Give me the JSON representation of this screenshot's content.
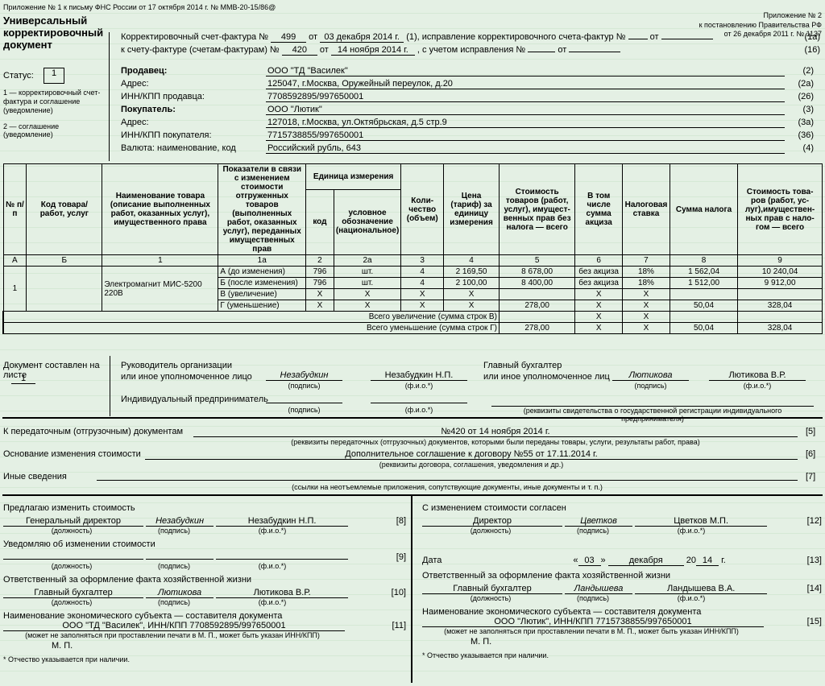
{
  "header": {
    "app1": "Приложение № 1 к письму ФНС России от 17 октября 2014 г. № ММВ-20-15/86@",
    "app2a": "Приложение № 2",
    "app2b": "к постановлению Правительства РФ",
    "app2c": "от 26 декабря 2011 г. № 1137"
  },
  "title": {
    "l1": "Универсальный",
    "l2": "корректировочный",
    "l3": "документ"
  },
  "status": {
    "label": "Статус:",
    "value": "1",
    "legend1": "1 — корректировочный счет-фактура и соглашение (уведомление)",
    "legend2": "2 — соглашение (уведомление)"
  },
  "corr": {
    "l1": "Корректировочный счет-фактура №",
    "n1": "499",
    "ot1": "от",
    "d1": "03 декабря 2014 г.",
    "fix": "(1), исправление корректировочного счета-фактур №",
    "ot3": "от",
    "b1": "(1а)",
    "l2": "к счету-фактуре (счетам-фактурам) №",
    "n2": "420",
    "ot2": "от",
    "d2": "14 ноября 2014 г.",
    "ispr": ", с учетом исправления №",
    "ot4": "от",
    "b2": "(16)"
  },
  "seller": {
    "label": "Продавец:",
    "name": "ООО \"ТД \"Василек\"",
    "addrlabel": "Адрес:",
    "addr": "125047, г.Москва, Оружейный переулок, д.20",
    "innlabel": "ИНН/КПП продавца:",
    "inn": "7708592895/997650001",
    "b1": "(2)",
    "b2": "(2а)",
    "b3": "(26)"
  },
  "buyer": {
    "label": "Покупатель:",
    "name": "ООО \"Лютик\"",
    "addrlabel": "Адрес:",
    "addr": "127018, г.Москва, ул.Октябрьская, д.5 стр.9",
    "innlabel": "ИНН/КПП покупателя:",
    "inn": "7715738855/997650001",
    "b1": "(3)",
    "b2": "(3а)",
    "b3": "(36)"
  },
  "currency": {
    "label": "Валюта: наименование, код",
    "value": "Российский рубль, 643",
    "b": "(4)"
  },
  "cols": {
    "c0": "№ п/п",
    "c1": "Код товара/ работ, услуг",
    "c2": "Наименование товара (описание выполненных работ, оказанных услуг), имущественного права",
    "c3": "Показатели в связи с изменением стоимости отгруженных товаров (выполненных работ, оказанных услуг), переданных имущественных прав",
    "c4": "Единица измерения",
    "c4a": "код",
    "c4b": "условное обозначение (национальное)",
    "c5": "Коли- чество (объем)",
    "c6": "Цена (тариф) за единицу измерения",
    "c7": "Стоимость товаров (работ, услуг), имущест- венных прав без налога — всего",
    "c8": "В том числе сумма акциза",
    "c9": "Налоговая ставка",
    "c10": "Сумма налога",
    "c11": "Стоимость това- ров (работ, ус- луг),имуществен- ных прав с нало- гом — всего"
  },
  "colnum": {
    "a": "А",
    "b": "Б",
    "c1": "1",
    "c1a": "1а",
    "c2": "2",
    "c2a": "2а",
    "c3": "3",
    "c4": "4",
    "c5": "5",
    "c6": "6",
    "c7": "7",
    "c8": "8",
    "c9": "9"
  },
  "row": {
    "n": "1",
    "name": "Электромагнит МИС-5200 220В",
    "rA": {
      "lbl": "А (до изменения)",
      "code": "796",
      "unit": "шт.",
      "qty": "4",
      "price": "2 169,50",
      "cost": "8 678,00",
      "acc": "без акциза",
      "rate": "18%",
      "tax": "1 562,04",
      "total": "10 240,04"
    },
    "rB": {
      "lbl": "Б (после изменения)",
      "code": "796",
      "unit": "шт.",
      "qty": "4",
      "price": "2 100,00",
      "cost": "8 400,00",
      "acc": "без акциза",
      "rate": "18%",
      "tax": "1 512,00",
      "total": "9 912,00"
    },
    "rV": {
      "lbl": "В (увеличение)",
      "code": "Х",
      "unit": "Х",
      "qty": "Х",
      "price": "Х",
      "cost": "",
      "acc": "Х",
      "rate": "Х",
      "tax": "",
      "total": ""
    },
    "rG": {
      "lbl": "Г (уменьшение)",
      "code": "Х",
      "unit": "Х",
      "qty": "Х",
      "price": "Х",
      "cost": "278,00",
      "acc": "Х",
      "rate": "Х",
      "tax": "50,04",
      "total": "328,04"
    }
  },
  "totals": {
    "inc": "Всего увеличение (сумма строк В)",
    "dec": "Всего уменьшение (сумма строк Г)",
    "x": "Х",
    "dcost": "278,00",
    "dtax": "50,04",
    "dtot": "328,04"
  },
  "sign": {
    "doclabel": "Документ составлен на листе",
    "page": "1",
    "rukorg": "Руководитель организации",
    "ili": "или иное уполномоченное лицо",
    "s1": "Незабудкин",
    "f1": "Незабудкин Н.П.",
    "glbuh": "Главный бухгалтер",
    "ili2": "или иное уполномоченное лиц",
    "s2": "Лютикова",
    "f2": "Лютикова В.Р.",
    "ip": "Индивидуальный предприниматель",
    "podp": "(подпись)",
    "fio": "(ф.и.о.*)",
    "rekv": "(реквизиты свидетельства о государственной регистрации индивидуального предпринимателя)"
  },
  "sec1": {
    "l": "К передаточным (отгрузочным) документам",
    "v": "№420 от 14 ноября 2014 г.",
    "h": "(реквизиты передаточных (отгрузочных) документов, которыми были переданы товары, услуги, результаты работ, права)",
    "b": "[5]"
  },
  "sec2": {
    "l": "Основание изменения стоимости",
    "v": "Дополнительное соглашение к договору №55 от 17.11.2014 г.",
    "h": "(реквизиты договора, соглашения, уведомления и др.)",
    "b": "[6]"
  },
  "sec3": {
    "l": "Иные сведения",
    "h": "(ссылки на неотъемлемые приложения, сопутствующие документы, иные документы и т. п.)",
    "b": "[7]"
  },
  "left": {
    "propose": "Предлагаю изменить стоимость",
    "dir": "Генеральный директор",
    "s": "Незабудкин",
    "f": "Незабудкин Н.П.",
    "b1": "[8]",
    "notify": "Уведомляю об изменении стоимости",
    "b2": "[9]",
    "resp": "Ответственный за оформление факта хозяйственной жизни",
    "gb": "Главный бухгалтер",
    "s2": "Лютикова",
    "f2": "Лютикова В.Р.",
    "b3": "[10]",
    "econ": "Наименование экономического субъекта — составителя документа",
    "econv": "ООО \"ТД \"Василек\", ИНН/КПП 7708592895/997650001",
    "b4": "[11]",
    "mp": "М. П.",
    "mpnote": "(может не заполняться при проставлении печати в М. П., может быть указан ИНН/КПП)",
    "dol": "(должность)",
    "star": "* Отчество указывается при наличии."
  },
  "right": {
    "agree": "С изменением стоимости согласен",
    "dir": "Директор",
    "s": "Цветков",
    "f": "Цветков М.П.",
    "b1": "[12]",
    "date": "Дата",
    "dd": "03",
    "mm": "декабря",
    "yy": "14",
    "pre": "«",
    "suf": "»",
    "yr": "20",
    "gr": "г.",
    "b2": "[13]",
    "resp": "Ответственный за оформление факта хозяйственной жизни",
    "gb": "Главный бухгалтер",
    "s2": "Ландышева",
    "f2": "Ландышева В.А.",
    "b3": "[14]",
    "econ": "Наименование экономического субъекта — составителя документа",
    "econv": "ООО \"Лютик\", ИНН/КПП 7715738855/997650001",
    "b4": "[15]",
    "mp": "М. П.",
    "mpnote": "(может не заполняться при проставлении печати в М. П., может быть указан ИНН/КПП)",
    "star": "* Отчество указывается при наличии."
  }
}
